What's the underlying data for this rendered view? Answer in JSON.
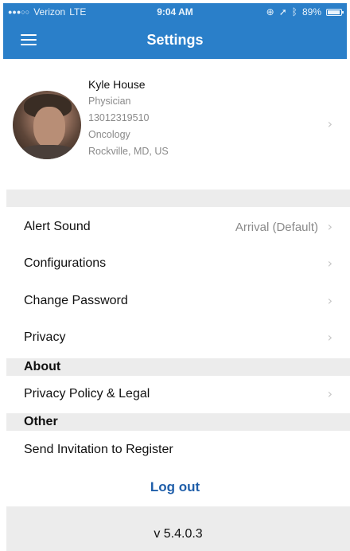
{
  "status_bar": {
    "carrier": "Verizon",
    "network": "LTE",
    "time": "9:04 AM",
    "battery": "89%",
    "signal_dots": "●●●○○",
    "icons": [
      "alarm-icon",
      "location-icon",
      "bluetooth-icon",
      "battery-icon"
    ]
  },
  "header": {
    "title": "Settings",
    "menu_icon": "hamburger-menu-icon"
  },
  "profile": {
    "name": "Kyle House",
    "role": "Physician",
    "phone": "13012319510",
    "specialty": "Oncology",
    "location": "Rockville, MD, US"
  },
  "settings": {
    "alert_sound_label": "Alert Sound",
    "alert_sound_value": "Arrival (Default)",
    "configurations_label": "Configurations",
    "change_password_label": "Change Password",
    "privacy_label": "Privacy"
  },
  "about": {
    "section_label": "About",
    "privacy_policy_label": "Privacy Policy & Legal"
  },
  "other": {
    "section_label": "Other",
    "send_invitation_label": "Send Invitation to Register"
  },
  "logout_label": "Log out",
  "version": "v 5.4.0.3",
  "chevron_glyph": "›",
  "colors": {
    "header_blue": "#2a7fc9",
    "logout_blue": "#1f5ea9",
    "section_gray": "#ececec"
  }
}
